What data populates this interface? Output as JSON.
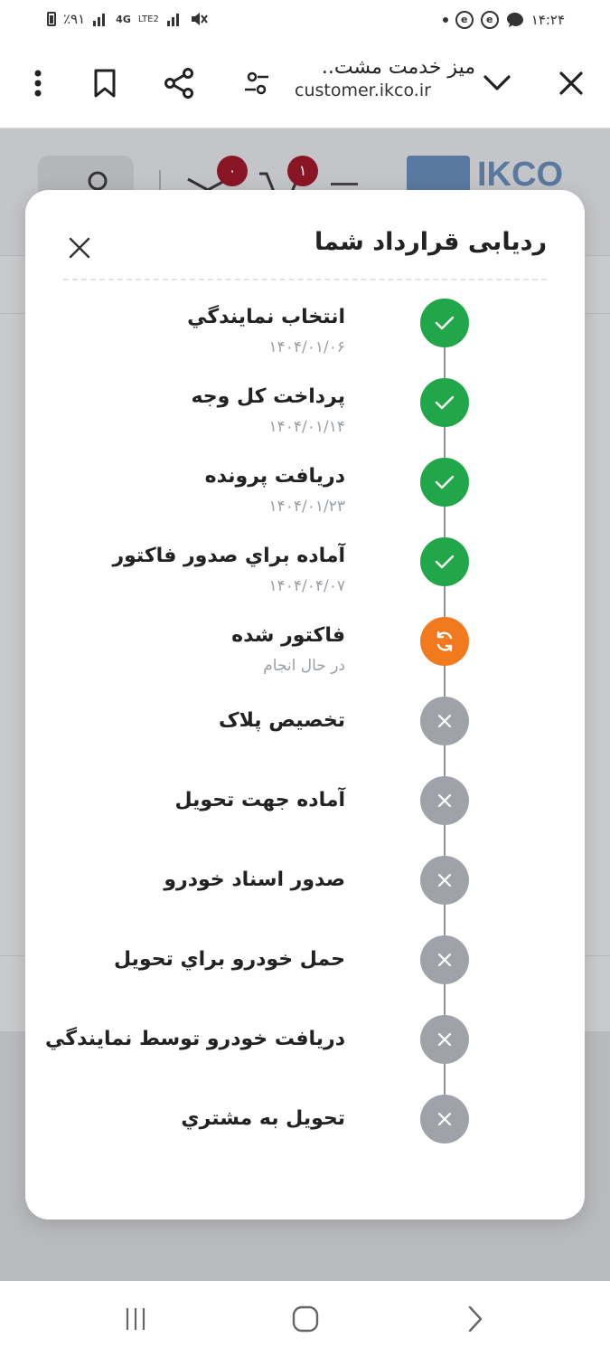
{
  "status_bar": {
    "left_text": "٪۹۱",
    "network": "4G",
    "network_sub": "LTE2",
    "time": "۱۴:۲۴"
  },
  "browser": {
    "title": "میز خدمت مشت..",
    "url": "customer.ikco.ir"
  },
  "site_header": {
    "cart_badge": "۱",
    "message_badge": "۰",
    "logo_text": "IKCO"
  },
  "modal": {
    "title": "ردیابی قرارداد شما",
    "steps": [
      {
        "label": "انتخاب نمايندگي",
        "date": "۱۴۰۴/۰۱/۰۶",
        "status": "done"
      },
      {
        "label": "پرداخت کل وجه",
        "date": "۱۴۰۴/۰۱/۱۴",
        "status": "done"
      },
      {
        "label": "دریافت پرونده",
        "date": "۱۴۰۴/۰۱/۲۳",
        "status": "done"
      },
      {
        "label": "آماده براي صدور فاکتور",
        "date": "۱۴۰۴/۰۴/۰۷",
        "status": "done"
      },
      {
        "label": "فاکتور شده",
        "date": "در حال انجام",
        "status": "in-progress"
      },
      {
        "label": "تخصیص پلاک",
        "date": "",
        "status": "pending"
      },
      {
        "label": "آماده جهت تحویل",
        "date": "",
        "status": "pending"
      },
      {
        "label": "صدور اسناد خودرو",
        "date": "",
        "status": "pending"
      },
      {
        "label": "حمل خودرو براي تحويل",
        "date": "",
        "status": "pending"
      },
      {
        "label": "دريافت خودرو توسط نمايندگي",
        "date": "",
        "status": "pending"
      },
      {
        "label": "تحويل به مشتري",
        "date": "",
        "status": "pending"
      }
    ]
  },
  "colors": {
    "done": "#22a64a",
    "in_progress": "#f27a1e",
    "pending": "#9fa3a9"
  }
}
